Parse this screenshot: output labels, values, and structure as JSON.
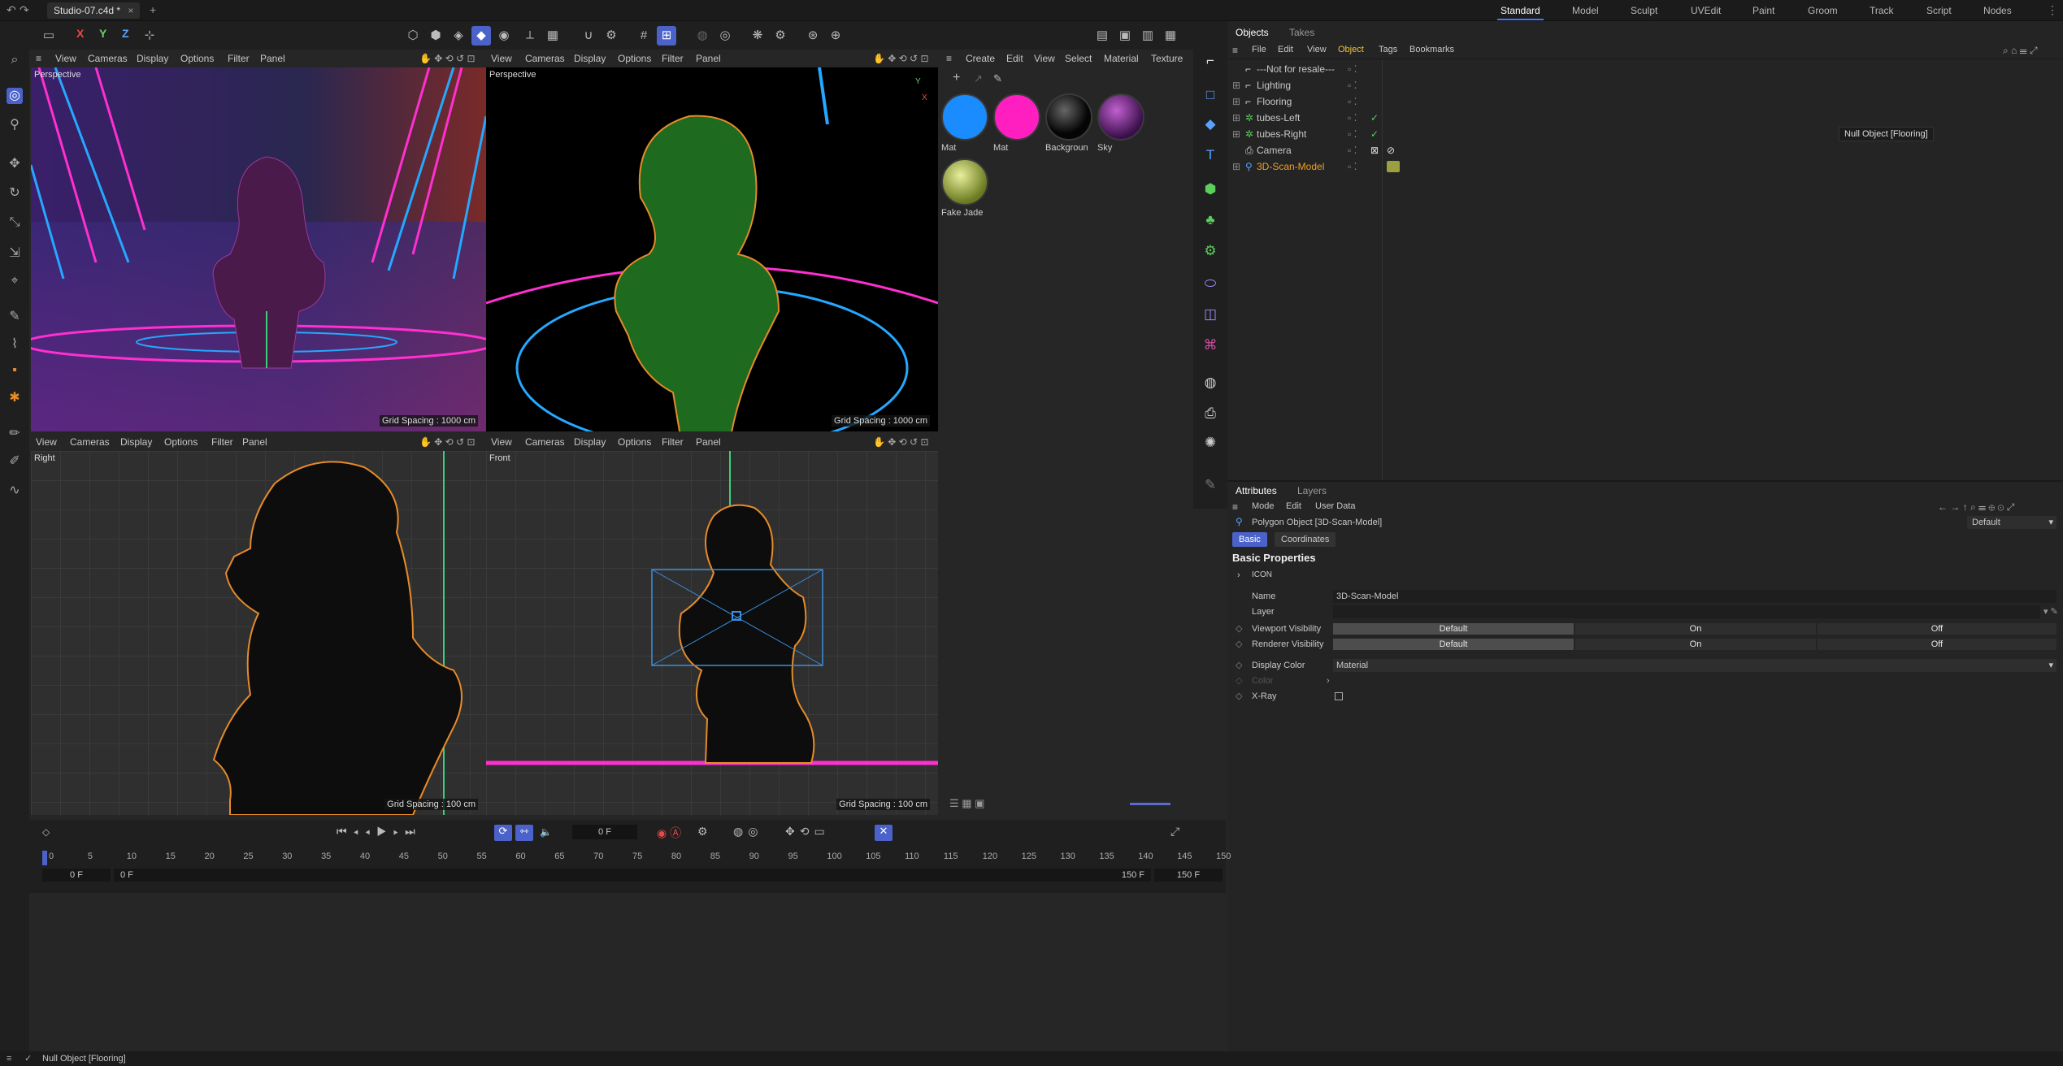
{
  "window": {
    "title": "Studio-07.c4d *",
    "layouts": [
      "Standard",
      "Model",
      "Sculpt",
      "UVEdit",
      "Paint",
      "Groom",
      "Track",
      "Script",
      "Nodes"
    ]
  },
  "tools": {
    "axis": [
      "X",
      "Y",
      "Z"
    ]
  },
  "viewports": [
    {
      "menu": [
        "View",
        "Cameras",
        "Display",
        "Options",
        "Filter",
        "Panel"
      ],
      "name": "Perspective",
      "grid": "Grid Spacing : 1000 cm"
    },
    {
      "menu": [
        "View",
        "Cameras",
        "Display",
        "Options",
        "Filter",
        "Panel"
      ],
      "name": "Perspective",
      "grid": "Grid Spacing : 1000 cm"
    },
    {
      "menu": [
        "View",
        "Cameras",
        "Display",
        "Options",
        "Filter",
        "Panel"
      ],
      "name": "Right",
      "grid": "Grid Spacing : 100 cm"
    },
    {
      "menu": [
        "View",
        "Cameras",
        "Display",
        "Options",
        "Filter",
        "Panel"
      ],
      "name": "Front",
      "grid": "Grid Spacing : 100 cm"
    }
  ],
  "materials": {
    "menu": [
      "Create",
      "Edit",
      "View",
      "Select",
      "Material",
      "Texture"
    ],
    "items": [
      {
        "name": "Mat",
        "color": "#1a8cff"
      },
      {
        "name": "Mat",
        "color": "#ff1fc0"
      },
      {
        "name": "Backgroun",
        "color": "#050505"
      },
      {
        "name": "Sky",
        "color": "#6a1f7a"
      },
      {
        "name": "Fake Jade",
        "color": "#a7b24a"
      }
    ]
  },
  "objects": {
    "tabs": [
      "Objects",
      "Takes"
    ],
    "menu": [
      "File",
      "Edit",
      "View",
      "Object",
      "Tags",
      "Bookmarks"
    ],
    "rows": [
      {
        "name": "---Not for resale---",
        "color": "#c8c8c8"
      },
      {
        "name": "Lighting",
        "color": "#c8c8c8"
      },
      {
        "name": "Flooring",
        "color": "#c8c8c8"
      },
      {
        "name": "tubes-Left",
        "color": "#c8c8c8"
      },
      {
        "name": "tubes-Right",
        "color": "#c8c8c8"
      },
      {
        "name": "Camera",
        "color": "#c8c8c8"
      },
      {
        "name": "3D-Scan-Model",
        "color": "#f0a020"
      }
    ],
    "tooltip": "Null Object [Flooring]"
  },
  "attributes": {
    "tabs": [
      "Attributes",
      "Layers"
    ],
    "menu": [
      "Mode",
      "Edit",
      "User Data"
    ],
    "object_title": "Polygon Object [3D-Scan-Model]",
    "preset": "Default",
    "subtabs": [
      "Basic",
      "Coordinates"
    ],
    "section": "Basic Properties",
    "icon_group": "ICON",
    "name_label": "Name",
    "name_value": "3D-Scan-Model",
    "layer_label": "Layer",
    "viewport_vis": "Viewport Visibility",
    "renderer_vis": "Renderer Visibility",
    "vis_options": [
      "Default",
      "On",
      "Off"
    ],
    "display_color": "Display Color",
    "display_color_value": "Material",
    "color": "Color",
    "xray": "X-Ray"
  },
  "timeline": {
    "frame": "0 F",
    "ticks": [
      "0",
      "5",
      "10",
      "15",
      "20",
      "25",
      "30",
      "35",
      "40",
      "45",
      "50",
      "55",
      "60",
      "65",
      "70",
      "75",
      "80",
      "85",
      "90",
      "95",
      "100",
      "105",
      "110",
      "115",
      "120",
      "125",
      "130",
      "135",
      "140",
      "145",
      "150"
    ],
    "start_a": "0 F",
    "start_b": "0 F",
    "end_a": "150 F",
    "end_b": "150 F"
  },
  "status": "Null Object [Flooring]"
}
